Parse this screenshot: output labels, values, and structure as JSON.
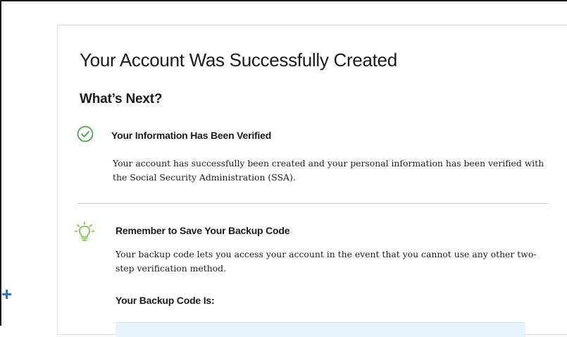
{
  "card": {
    "title": "Your Account Was Successfully Created",
    "subtitle": "What’s Next?"
  },
  "steps": [
    {
      "icon": "check-circle-icon",
      "heading": "Your Information Has Been Verified",
      "body": "Your account has successfully been created and your personal information has been verified with the Social Security Administration (SSA)."
    },
    {
      "icon": "lightbulb-icon",
      "heading": "Remember to Save Your Backup Code",
      "body": "Your backup code lets you access your account in the event that you cannot use any other two-step verification method."
    }
  ],
  "backup": {
    "label": "Your Backup Code Is:"
  },
  "colors": {
    "success": "#3e9b3e",
    "bulb": "#6dbf3a",
    "code_box": "#e7f4fb",
    "plus": "#2f6fb3"
  }
}
